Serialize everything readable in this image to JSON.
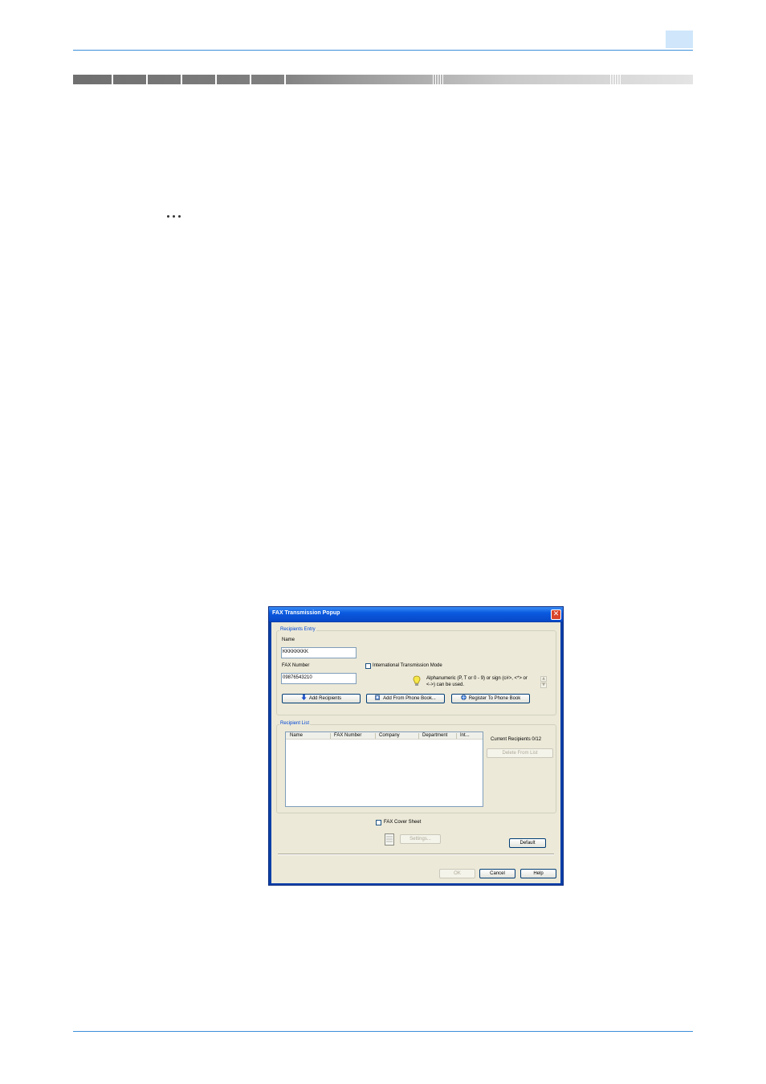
{
  "dialog": {
    "title": "FAX Transmission Popup",
    "close_symbol": "✕",
    "recipients_entry": {
      "group_label": "Recipients Entry",
      "name_label": "Name",
      "name_value": "KKKKKKKK",
      "fax_number_label": "FAX Number",
      "fax_number_value": "09876543210",
      "intl_mode_label": "International Transmission Mode",
      "intl_mode_checked": false,
      "hint_line1": "Alphanumeric (P, T or 0 - 9) or sign (c#>, <*> or",
      "hint_line2": "<->) can be used.",
      "hint_icon": "lightbulb-icon",
      "buttons": {
        "add_recipients": "Add Recipients",
        "add_from_phone_book": "Add From Phone Book...",
        "register_to_phone_book": "Register To Phone Book"
      }
    },
    "recipient_list": {
      "group_label": "Recipient List",
      "columns": [
        "Name",
        "FAX Number",
        "Company",
        "Department",
        "Int..."
      ],
      "rows": [],
      "current_recipients": "Current Recipients 0/12",
      "delete_button": "Delete From List"
    },
    "cover_sheet": {
      "label": "FAX Cover Sheet",
      "checked": false,
      "settings_button": "Settings..."
    },
    "default_button": "Default",
    "ok_button": "OK",
    "cancel_button": "Cancel",
    "help_button": "Help"
  },
  "colors": {
    "title_bar": "#0a5ae0",
    "dialog_bg": "#ece9d8",
    "group_label": "#0046d5",
    "page_rule": "#3b8fd9"
  }
}
